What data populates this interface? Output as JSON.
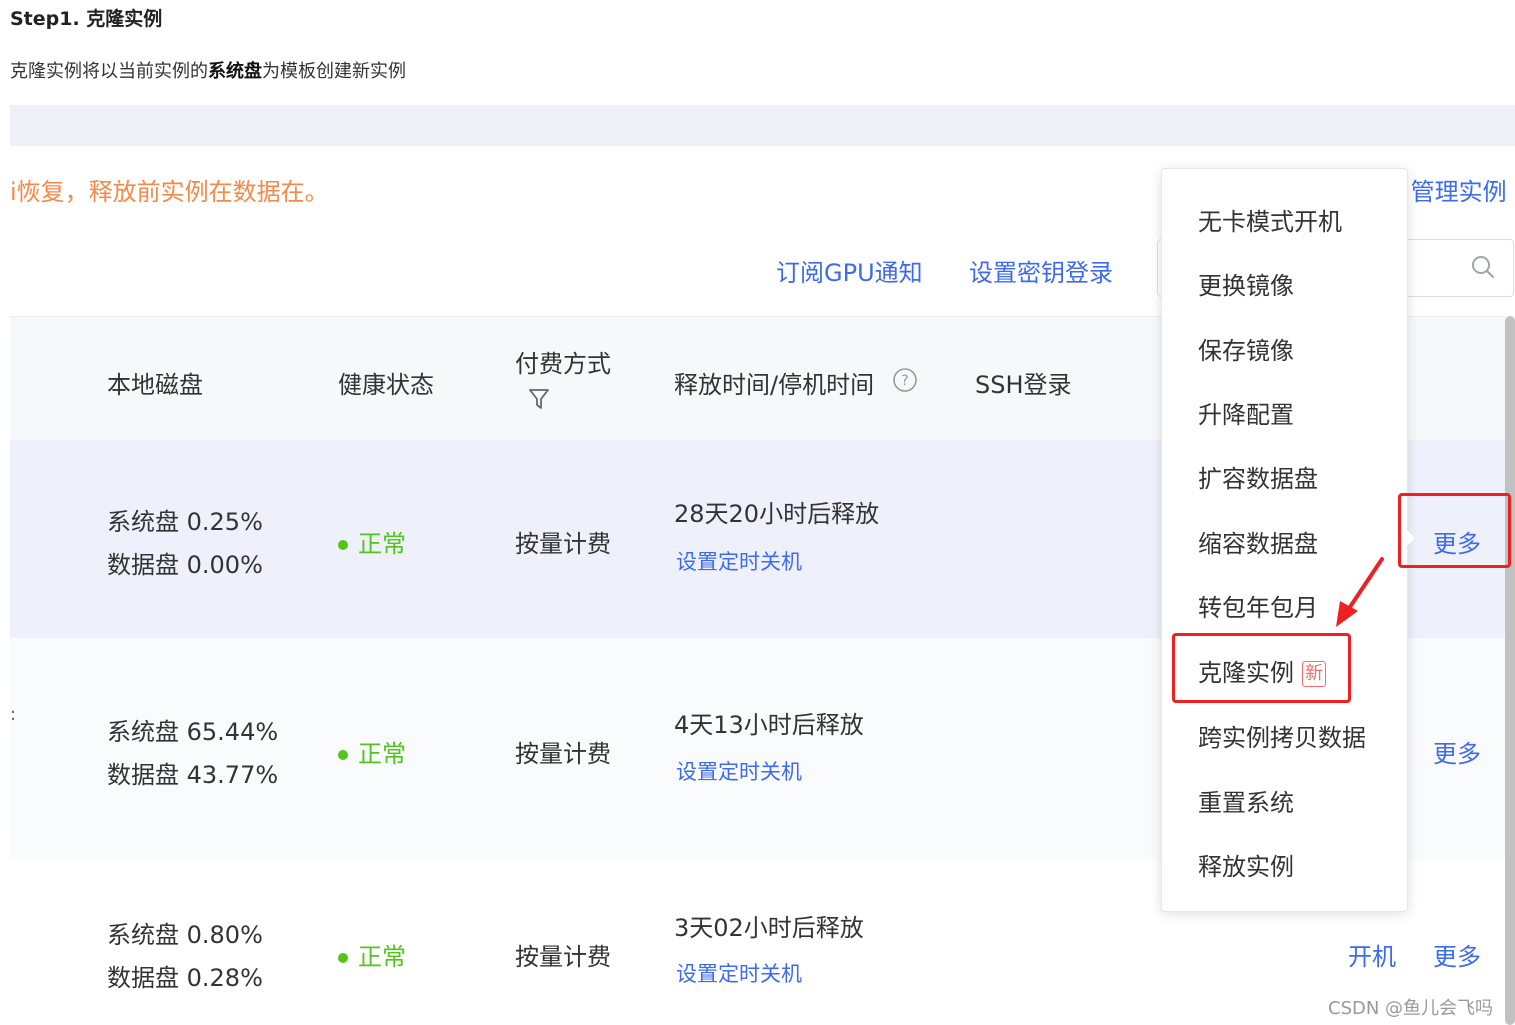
{
  "doc": {
    "step_title": "Step1. 克隆实例",
    "desc_prefix": "克隆实例将以当前实例的",
    "desc_bold": "系统盘",
    "desc_suffix": "为模板创建新实例"
  },
  "page": {
    "warning_text": "i恢复，释放前实例在数据在。",
    "manage_link": "·管理实例",
    "subscribe_gpu": "订阅GPU通知",
    "set_key_login": "设置密钥登录"
  },
  "table": {
    "headers": {
      "local_disk": "本地磁盘",
      "health": "健康状态",
      "billing": "付费方式",
      "release_time": "释放时间/停机时间",
      "ssh": "SSH登录"
    },
    "rows": [
      {
        "system_disk": "系统盘 0.25%",
        "data_disk": "数据盘 0.00%",
        "health": "正常",
        "billing": "按量计费",
        "release": "28天20小时后释放",
        "schedule": "设置定时关机",
        "action": "",
        "more": "更多"
      },
      {
        "system_disk": "系统盘 65.44%",
        "data_disk": "数据盘 43.77%",
        "health": "正常",
        "billing": "按量计费",
        "release": "4天13小时后释放",
        "schedule": "设置定时关机",
        "action": "",
        "more": "更多"
      },
      {
        "system_disk": "系统盘 0.80%",
        "data_disk": "数据盘 0.28%",
        "health": "正常",
        "billing": "按量计费",
        "release": "3天02小时后释放",
        "schedule": "设置定时关机",
        "action": "开机",
        "more": "更多"
      }
    ]
  },
  "menu": {
    "items": [
      "无卡模式开机",
      "更换镜像",
      "保存镜像",
      "升降配置",
      "扩容数据盘",
      "缩容数据盘",
      "转包年包月",
      "克隆实例",
      "跨实例拷贝数据",
      "重置系统",
      "释放实例"
    ],
    "new_badge": "新"
  },
  "watermark": "CSDN @鱼儿会飞吗",
  "colors": {
    "link": "#3d6af2",
    "warning": "#f5894a",
    "ok": "#52c41a",
    "highlight_box": "#f02020"
  }
}
